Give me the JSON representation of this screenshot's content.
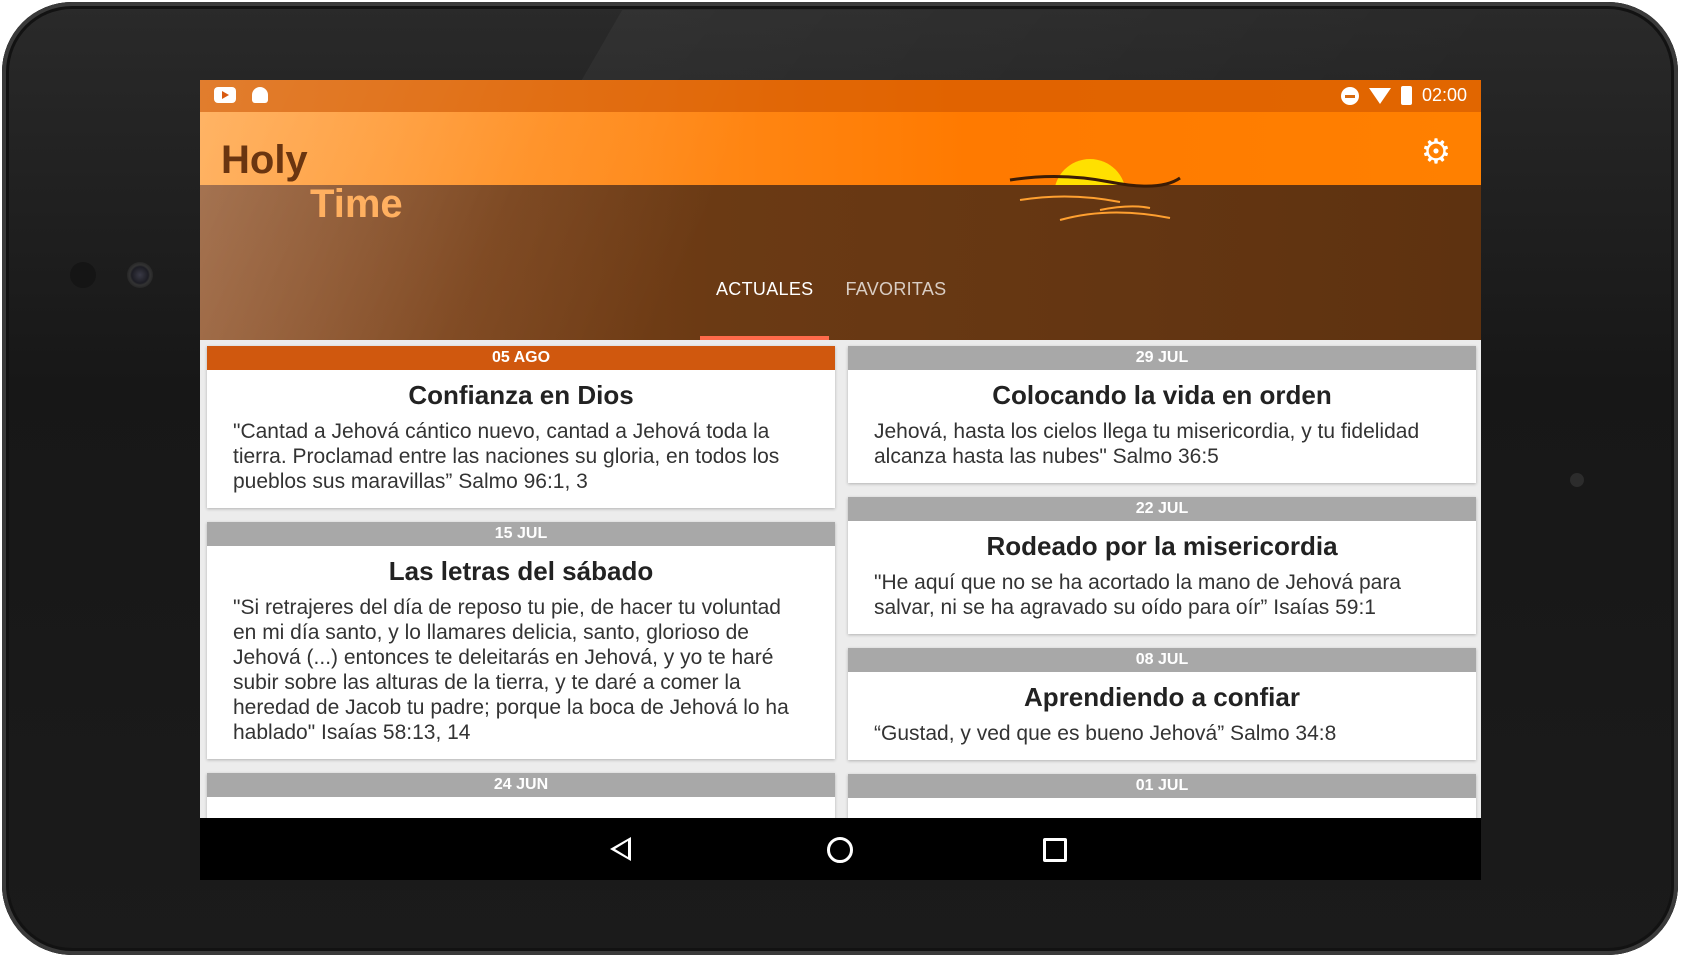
{
  "status_bar": {
    "time": "02:00"
  },
  "app": {
    "title_line1": "Holy",
    "title_line2": "Time"
  },
  "tabs": [
    {
      "label": "ACTUALES",
      "active": true
    },
    {
      "label": "FAVORITAS",
      "active": false
    }
  ],
  "cards_left": [
    {
      "date": "05 AGO",
      "title": "Confianza en Dios",
      "text": "\"Cantad a Jehová cántico nuevo, cantad a Jehová toda la tierra. Proclamad entre las naciones su gloria, en todos los pueblos sus maravillas” Salmo 96:1, 3"
    },
    {
      "date": "15 JUL",
      "title": "Las letras del sábado",
      "text": "\"Si retrajeres del día de reposo tu pie, de hacer tu voluntad en mi día santo, y lo llamares delicia, santo, glorioso de Jehová (...) entonces te deleitarás en Jehová, y yo te haré subir sobre las alturas de la tierra, y te daré a comer la heredad de Jacob tu padre; porque la boca de Jehová lo ha hablado\" Isaías 58:13, 14"
    },
    {
      "date": "24 JUN",
      "title": "",
      "text": ""
    }
  ],
  "cards_right": [
    {
      "date": "29 JUL",
      "title": "Colocando la vida en orden",
      "text": "Jehová, hasta los cielos llega tu misericordia, y tu fidelidad alcanza hasta las nubes\" Salmo 36:5"
    },
    {
      "date": "22 JUL",
      "title": "Rodeado por la misericordia",
      "text": "\"He aquí que no se ha acortado la mano de Jehová para salvar, ni se ha agravado su oído para oír” Isaías 59:1"
    },
    {
      "date": "08 JUL",
      "title": "Aprendiendo a confiar",
      "text": "“Gustad, y ved que es bueno Jehová” Salmo 34:8"
    },
    {
      "date": "01 JUL",
      "title": "",
      "text": ""
    }
  ],
  "colors": {
    "accent": "#d0580e",
    "header_orange": "#ff8a1a",
    "header_brown": "#6b3a14",
    "tab_indicator": "#ff6a4a"
  },
  "icons": {
    "settings": "gear-icon",
    "sun": "sun-icon"
  }
}
